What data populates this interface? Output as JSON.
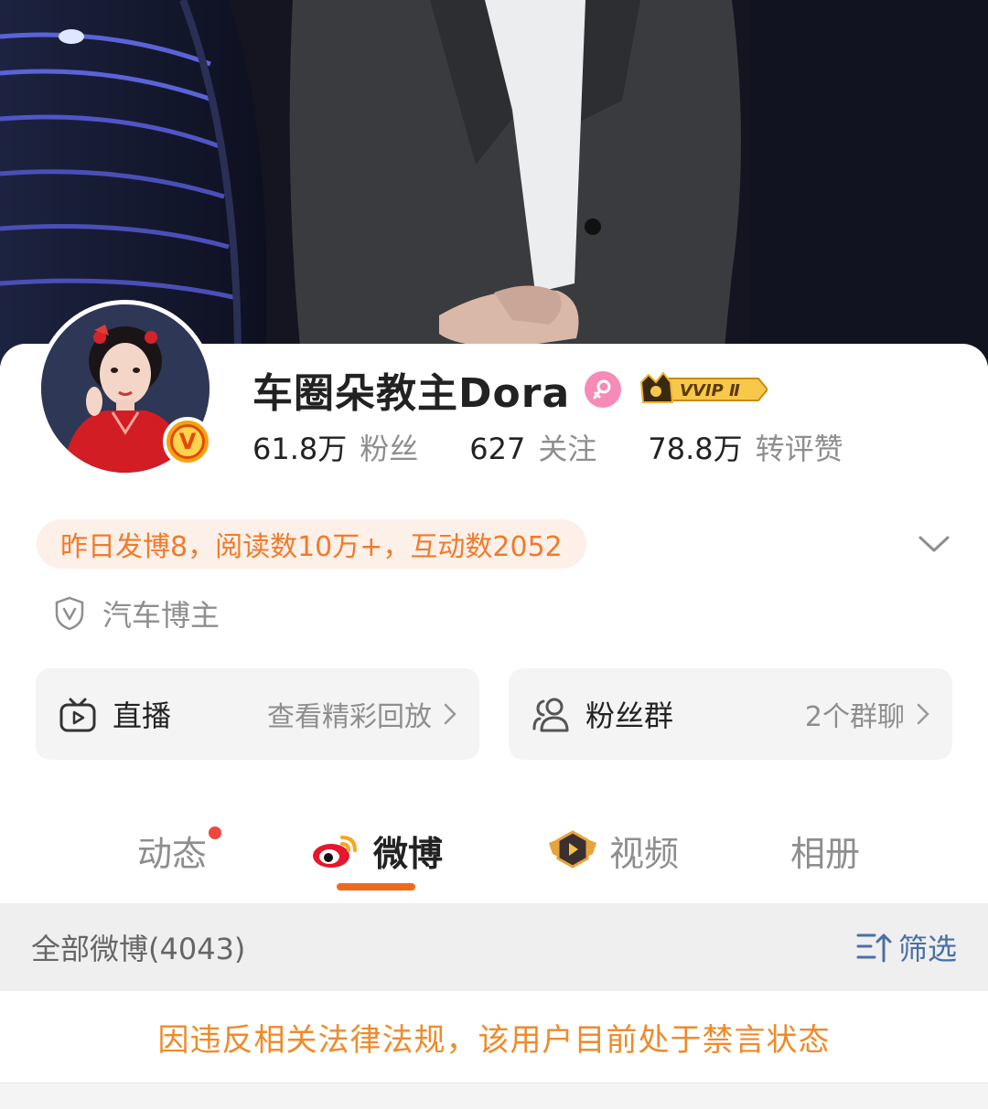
{
  "profile": {
    "name": "车圈朵教主Dora",
    "vip_badge": "VVIP Ⅱ",
    "gender_icon": "female-icon",
    "verified_badge": "V",
    "stats": [
      {
        "value": "61.8万",
        "label": "粉丝"
      },
      {
        "value": "627",
        "label": "关注"
      },
      {
        "value": "78.8万",
        "label": "转评赞"
      }
    ],
    "activity_summary": "昨日发博8，阅读数10万+，互动数2052",
    "category_tag": "汽车博主"
  },
  "features": {
    "live": {
      "title": "直播",
      "action": "查看精彩回放",
      "icon": "tv-icon"
    },
    "fan_group": {
      "title": "粉丝群",
      "action": "2个群聊",
      "icon": "group-icon"
    }
  },
  "tabs": [
    {
      "label": "动态",
      "has_dot": true
    },
    {
      "label": "微博",
      "active": true,
      "icon": "weibo-logo-icon"
    },
    {
      "label": "视频",
      "icon": "video-play-icon"
    },
    {
      "label": "相册"
    }
  ],
  "feed": {
    "title": "全部微博(4043)",
    "filter_label": "筛选",
    "notice": "因违反相关法律法规，该用户目前处于禁言状态"
  },
  "colors": {
    "accent_orange": "#f06a1b",
    "notice_orange": "#f08a2a",
    "filter_blue": "#4a6fa5",
    "notification_red": "#f0463b"
  }
}
